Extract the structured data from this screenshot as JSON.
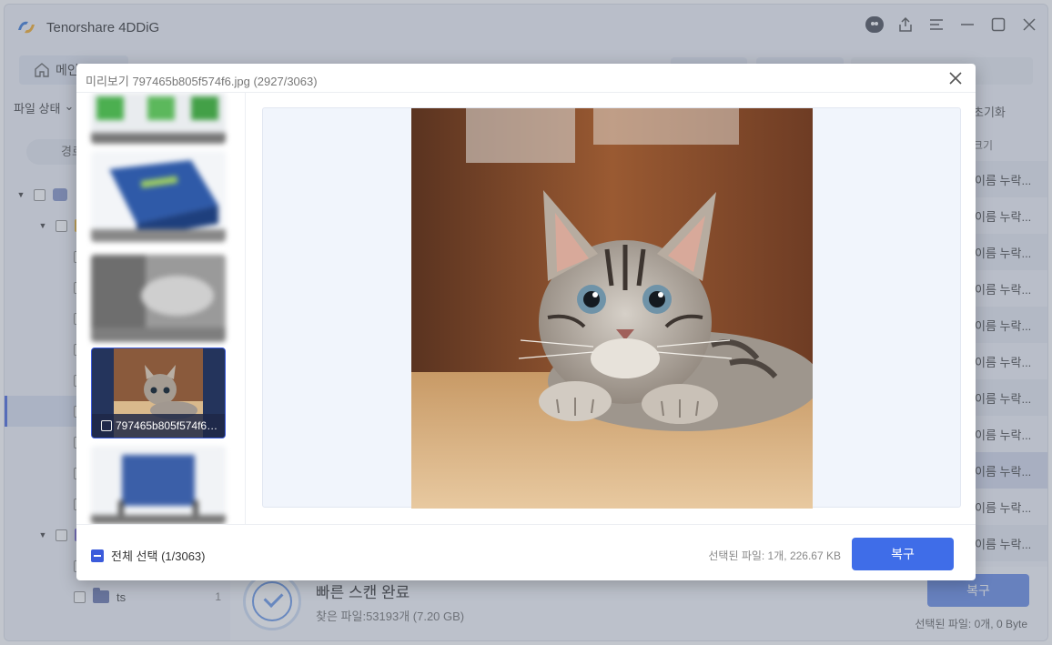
{
  "app": {
    "title": "Tenorshare 4DDiG",
    "home_tab_label": "메인",
    "filter_label": "파일 상태",
    "tree_pill_label": "경로",
    "tree_last_folder": "ts",
    "tree_last_count": "1",
    "right_header": "초기화",
    "right_sub": "크기",
    "right_rows": [
      "이름 누락...",
      "이름 누락...",
      "이름 누락...",
      "이름 누락...",
      "이름 누락...",
      "이름 누락...",
      "이름 누락...",
      "이름 누락...",
      "이름 누락...",
      "이름 누락...",
      "이름 누락..."
    ],
    "scan_title": "빠른 스캔 완료",
    "scan_found": "찾은 파일:53193개 (7.20 GB)",
    "recover_label": "복구",
    "selected_status": "선택된 파일: 0개, 0 Byte"
  },
  "modal": {
    "title": "미리보기 797465b805f574f6.jpg (2927/3063)",
    "selected_thumb_name": "797465b805f574f6.jpg",
    "select_all_label": "전체 선택 (1/3063)",
    "selected_status": "선택된 파일: 1개, 226.67 KB",
    "recover_label": "복구"
  },
  "colors": {
    "accent": "#3f6de8",
    "selected_border": "#3b5bdb"
  },
  "icons": {
    "logo": "tenorshare-logo-icon",
    "close": "close-icon",
    "home": "home-icon"
  }
}
